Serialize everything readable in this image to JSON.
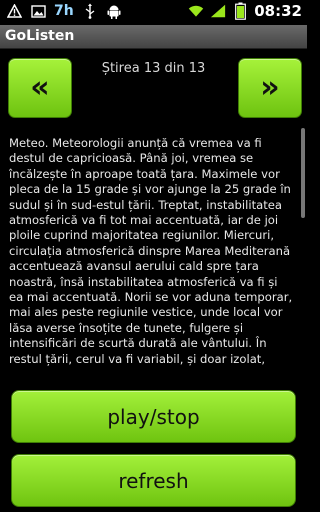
{
  "status_bar": {
    "icons": [
      "warning-icon",
      "image-icon",
      "usb-icon",
      "android-icon",
      "wifi-icon",
      "signal-icon",
      "battery-icon"
    ],
    "indicator": "7h",
    "time": "08:32"
  },
  "app": {
    "title": "GoListen"
  },
  "nav": {
    "prev_label": "«",
    "next_label": "»",
    "counter": "Știrea 13 din 13"
  },
  "article": {
    "text": "Meteo. Meteorologii anunță că vremea va fi destul de capricioasă. Până joi, vremea se încălzește în aproape toată țara. Maximele vor pleca de la 15 grade și vor ajunge la  25 grade în sudul și în sud-estul țării. Treptat, instabilitatea atmosferică va fi tot mai accentuată, iar de joi ploile cuprind majoritatea regiunilor. Miercuri, circulația atmosferică dinspre Marea Mediterană accentuează avansul aerului cald spre țara noastră, însă instabilitatea atmosferică va fi și ea mai accentuată. Norii se vor aduna temporar, mai ales peste regiunile vestice, unde local vor lăsa averse însoțite de tunete, fulgere și intensificări de scurtă durată ale vântului. În restul țării, cerul va fi variabil, și doar izolat, după-amiază și spre seară, vor fi posibile"
  },
  "buttons": {
    "play_stop": "play/stop",
    "refresh": "refresh"
  },
  "colors": {
    "button_green": "#8ddc28",
    "background": "#000000",
    "titlebar": "#555555"
  }
}
